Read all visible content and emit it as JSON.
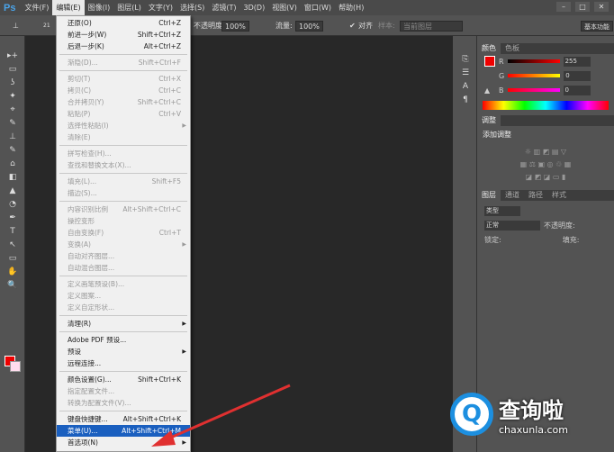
{
  "app": {
    "logo": "Ps"
  },
  "menubar": [
    "文件(F)",
    "编辑(E)",
    "图像(I)",
    "图层(L)",
    "文字(Y)",
    "选择(S)",
    "滤镜(T)",
    "3D(D)",
    "视图(V)",
    "窗口(W)",
    "帮助(H)"
  ],
  "window_controls": [
    "–",
    "□",
    "✕"
  ],
  "options": {
    "brush_size": "21",
    "opacity_label": "不透明度:",
    "opacity": "100%",
    "flow_label": "流量:",
    "flow": "100%",
    "align_label": "对齐",
    "sample_label": "样本:",
    "sample_value": "当前图层",
    "workspace": "基本功能"
  },
  "tools": [
    "▸+",
    "▭",
    "ʖ",
    "✦",
    "⌖",
    "✎",
    "⊥",
    "✎",
    "⌂",
    "◧",
    "▲",
    "◔",
    "✒",
    "T",
    "↖",
    "▭",
    "✋",
    "🔍"
  ],
  "edit_menu": [
    {
      "label": "还原(O)",
      "shortcut": "Ctrl+Z"
    },
    {
      "label": "前进一步(W)",
      "shortcut": "Shift+Ctrl+Z"
    },
    {
      "label": "后退一步(K)",
      "shortcut": "Alt+Ctrl+Z"
    },
    {
      "sep": true
    },
    {
      "label": "渐隐(D)...",
      "shortcut": "Shift+Ctrl+F",
      "disabled": true
    },
    {
      "sep": true
    },
    {
      "label": "剪切(T)",
      "shortcut": "Ctrl+X",
      "disabled": true
    },
    {
      "label": "拷贝(C)",
      "shortcut": "Ctrl+C",
      "disabled": true
    },
    {
      "label": "合并拷贝(Y)",
      "shortcut": "Shift+Ctrl+C",
      "disabled": true
    },
    {
      "label": "粘贴(P)",
      "shortcut": "Ctrl+V",
      "disabled": true
    },
    {
      "label": "选择性粘贴(I)",
      "submenu": true,
      "disabled": true
    },
    {
      "label": "清除(E)",
      "disabled": true
    },
    {
      "sep": true
    },
    {
      "label": "拼写检查(H)...",
      "disabled": true
    },
    {
      "label": "查找和替换文本(X)...",
      "disabled": true
    },
    {
      "sep": true
    },
    {
      "label": "填充(L)...",
      "shortcut": "Shift+F5",
      "disabled": true
    },
    {
      "label": "描边(S)...",
      "disabled": true
    },
    {
      "sep": true
    },
    {
      "label": "内容识别比例",
      "shortcut": "Alt+Shift+Ctrl+C",
      "disabled": true
    },
    {
      "label": "操控变形",
      "disabled": true
    },
    {
      "label": "自由变换(F)",
      "shortcut": "Ctrl+T",
      "disabled": true
    },
    {
      "label": "变换(A)",
      "submenu": true,
      "disabled": true
    },
    {
      "label": "自动对齐图层...",
      "disabled": true
    },
    {
      "label": "自动混合图层...",
      "disabled": true
    },
    {
      "sep": true
    },
    {
      "label": "定义画笔预设(B)...",
      "disabled": true
    },
    {
      "label": "定义图案...",
      "disabled": true
    },
    {
      "label": "定义自定形状...",
      "disabled": true
    },
    {
      "sep": true
    },
    {
      "label": "清理(R)",
      "submenu": true
    },
    {
      "sep": true
    },
    {
      "label": "Adobe PDF 预设..."
    },
    {
      "label": "预设",
      "submenu": true
    },
    {
      "label": "远程连接..."
    },
    {
      "sep": true
    },
    {
      "label": "颜色设置(G)...",
      "shortcut": "Shift+Ctrl+K"
    },
    {
      "label": "指定配置文件...",
      "disabled": true
    },
    {
      "label": "转换为配置文件(V)...",
      "disabled": true
    },
    {
      "sep": true
    },
    {
      "label": "键盘快捷键...",
      "shortcut": "Alt+Shift+Ctrl+K"
    },
    {
      "label": "菜单(U)...",
      "shortcut": "Alt+Shift+Ctrl+M",
      "highlighted": true
    },
    {
      "label": "首选项(N)",
      "submenu": true
    }
  ],
  "color_panel": {
    "tabs": [
      "颜色",
      "色板"
    ],
    "channels": [
      {
        "name": "R",
        "value": "255"
      },
      {
        "name": "G",
        "value": "0"
      },
      {
        "name": "B",
        "value": "0"
      }
    ]
  },
  "adjust_panel": {
    "tab": "调整",
    "title": "添加调整"
  },
  "layers_panel": {
    "tabs": [
      "图层",
      "通道",
      "路径",
      "样式"
    ],
    "kind": "类型",
    "blend": "正常",
    "opacity_label": "不透明度:",
    "lock_label": "锁定:",
    "fill_label": "填充:"
  },
  "watermark": {
    "logo": "Q",
    "name": "查询啦",
    "url": "chaxunla.com"
  },
  "colors": {
    "foreground": "#ee0000",
    "highlight": "#1a5fbf",
    "arrow": "#e03030"
  }
}
